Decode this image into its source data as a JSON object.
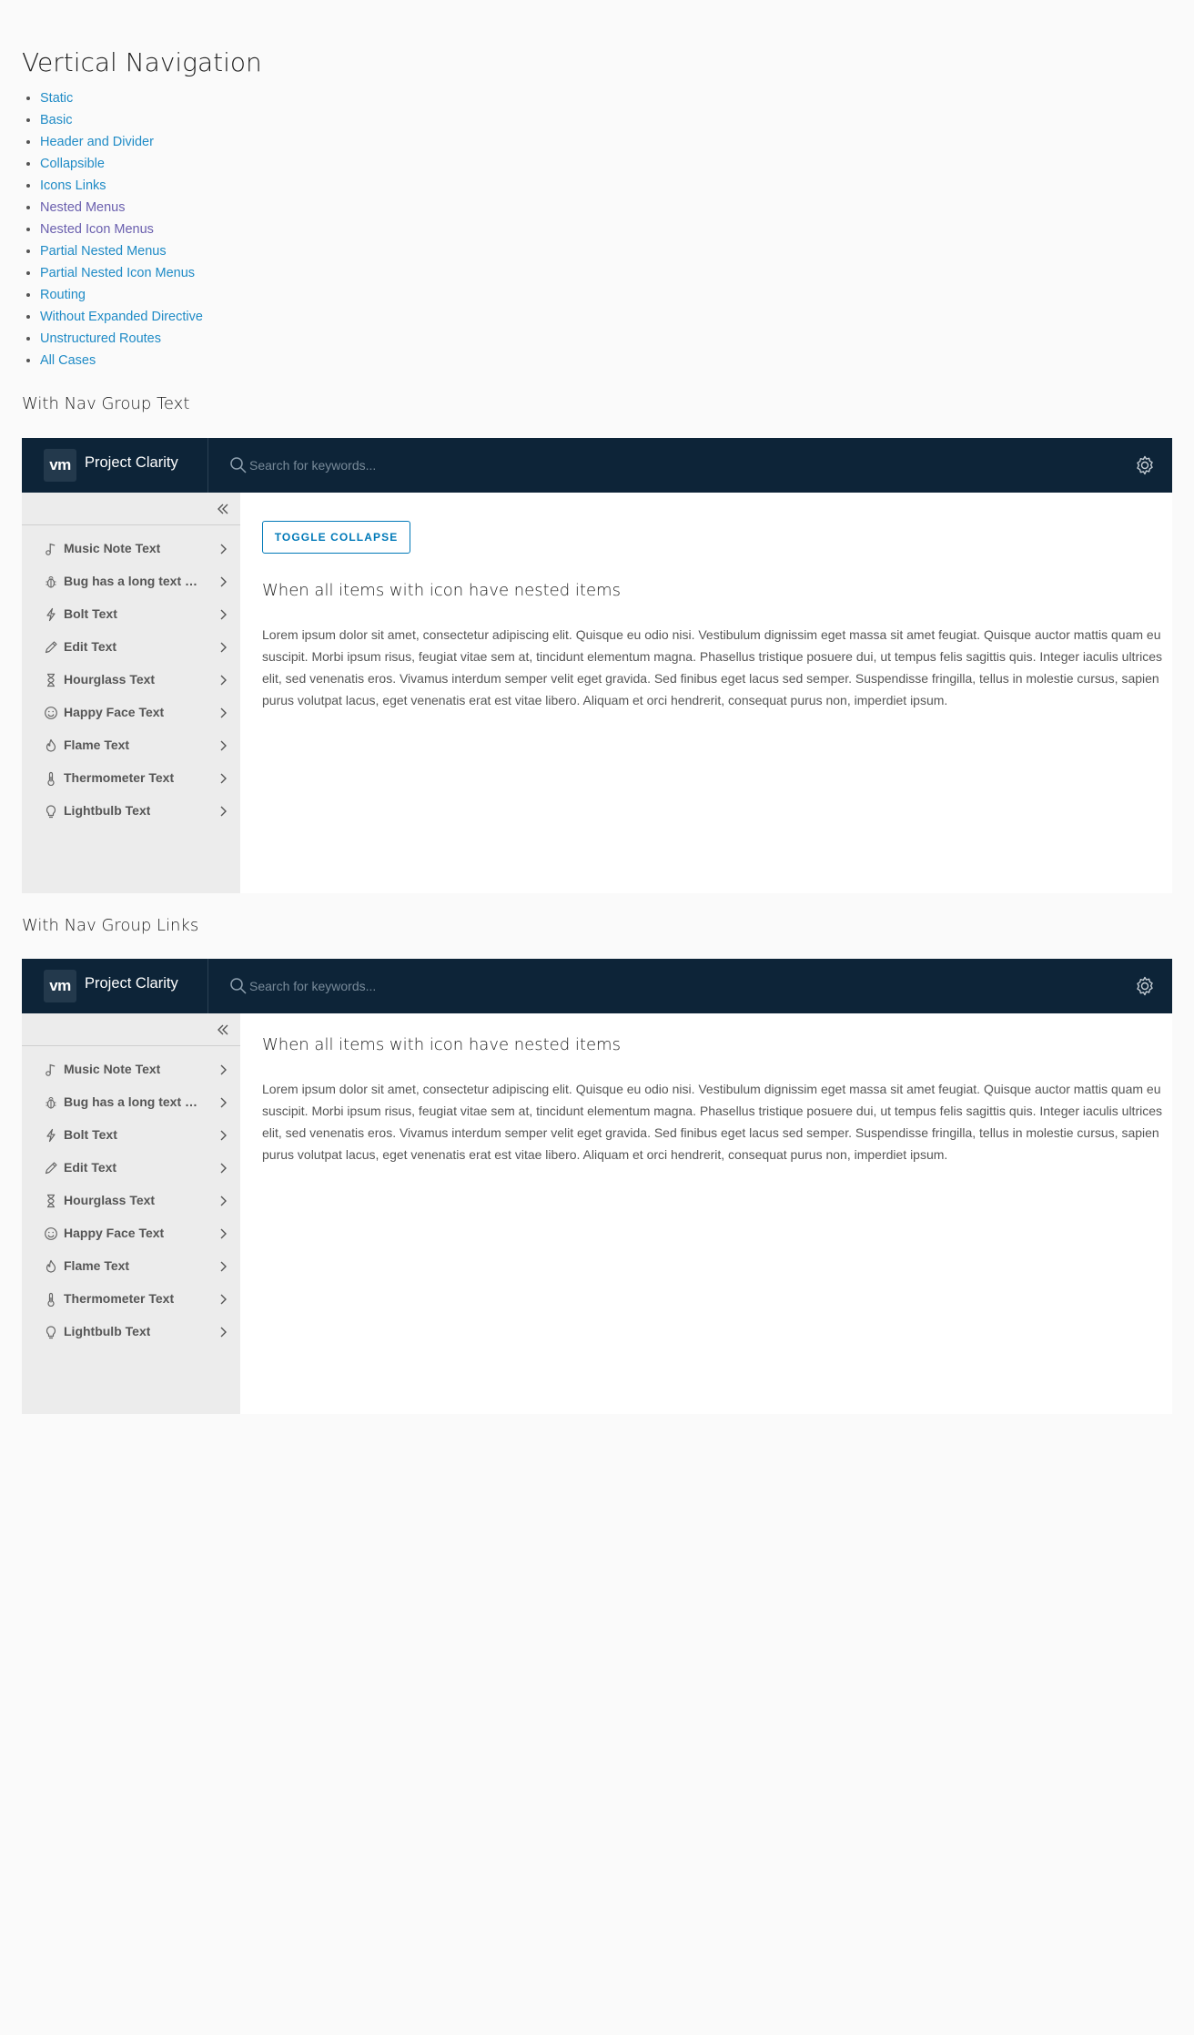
{
  "page": {
    "title": "Vertical Navigation",
    "links": [
      {
        "label": "Static",
        "visited": false
      },
      {
        "label": "Basic",
        "visited": false
      },
      {
        "label": "Header and Divider",
        "visited": false
      },
      {
        "label": "Collapsible",
        "visited": false
      },
      {
        "label": "Icons Links",
        "visited": false
      },
      {
        "label": "Nested Menus",
        "visited": true
      },
      {
        "label": "Nested Icon Menus",
        "visited": true
      },
      {
        "label": "Partial Nested Menus",
        "visited": false
      },
      {
        "label": "Partial Nested Icon Menus",
        "visited": false
      },
      {
        "label": "Routing",
        "visited": false
      },
      {
        "label": "Without Expanded Directive",
        "visited": false
      },
      {
        "label": "Unstructured Routes",
        "visited": false
      },
      {
        "label": "All Cases",
        "visited": false
      }
    ]
  },
  "header": {
    "logo": "vm",
    "brand": "Project Clarity",
    "search_placeholder": "Search for keywords..."
  },
  "nav_items": [
    {
      "label": "Music Note Text",
      "icon": "music-note-icon"
    },
    {
      "label": "Bug has a long text that will be truncated",
      "icon": "bug-icon"
    },
    {
      "label": "Bolt Text",
      "icon": "bolt-icon"
    },
    {
      "label": "Edit Text",
      "icon": "pencil-icon"
    },
    {
      "label": "Hourglass Text",
      "icon": "hourglass-icon"
    },
    {
      "label": "Happy Face Text",
      "icon": "happy-face-icon"
    },
    {
      "label": "Flame Text",
      "icon": "flame-icon"
    },
    {
      "label": "Thermometer Text",
      "icon": "thermometer-icon"
    },
    {
      "label": "Lightbulb Text",
      "icon": "lightbulb-icon"
    }
  ],
  "sections": [
    {
      "title": "With Nav Group Text",
      "toggle_label": "TOGGLE COLLAPSE",
      "content_title": "When all items with icon have nested items",
      "content_text": "Lorem ipsum dolor sit amet, consectetur adipiscing elit. Quisque eu odio nisi. Vestibulum dignissim eget massa sit amet feugiat. Quisque auctor mattis quam eu suscipit. Morbi ipsum risus, feugiat vitae sem at, tincidunt elementum magna. Phasellus tristique posuere dui, ut tempus felis sagittis quis. Integer iaculis ultrices elit, sed venenatis eros. Vivamus interdum semper velit eget gravida. Sed finibus eget lacus sed semper. Suspendisse fringilla, tellus in molestie cursus, sapien purus volutpat lacus, eget venenatis erat est vitae libero. Aliquam et orci hendrerit, consequat purus non, imperdiet ipsum."
    },
    {
      "title": "With Nav Group Links",
      "content_title": "When all items with icon have nested items",
      "content_text": "Lorem ipsum dolor sit amet, consectetur adipiscing elit. Quisque eu odio nisi. Vestibulum dignissim eget massa sit amet feugiat. Quisque auctor mattis quam eu suscipit. Morbi ipsum risus, feugiat vitae sem at, tincidunt elementum magna. Phasellus tristique posuere dui, ut tempus felis sagittis quis. Integer iaculis ultrices elit, sed venenatis eros. Vivamus interdum semper velit eget gravida. Sed finibus eget lacus sed semper. Suspendisse fringilla, tellus in molestie cursus, sapien purus volutpat lacus, eget venenatis erat est vitae libero. Aliquam et orci hendrerit, consequat purus non, imperdiet ipsum."
    }
  ],
  "colors": {
    "header_bg": "#0d2438",
    "sidebar_bg": "#ececec",
    "link": "#1f8bc6",
    "link_visited": "#6a5fae",
    "accent": "#0079b8"
  }
}
